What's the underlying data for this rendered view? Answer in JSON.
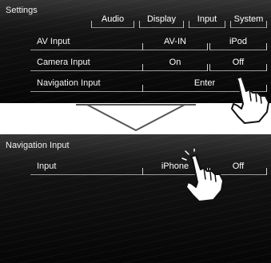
{
  "screen1": {
    "title": "Settings",
    "tabs": [
      {
        "label": "Audio"
      },
      {
        "label": "Display"
      },
      {
        "label": "Input"
      },
      {
        "label": "System"
      }
    ],
    "rows": [
      {
        "label": "AV Input",
        "options": [
          "AV-IN",
          "iPod"
        ]
      },
      {
        "label": "Camera Input",
        "options": [
          "On",
          "Off"
        ]
      },
      {
        "label": "Navigation Input",
        "options": [
          "Enter"
        ]
      }
    ]
  },
  "screen2": {
    "title": "Navigation Input",
    "rows": [
      {
        "label": "Input",
        "options": [
          "iPhone",
          "Off"
        ]
      }
    ]
  },
  "icons": {
    "transition": "down-arrow-icon",
    "pointer": "hand-pointer-icon"
  }
}
